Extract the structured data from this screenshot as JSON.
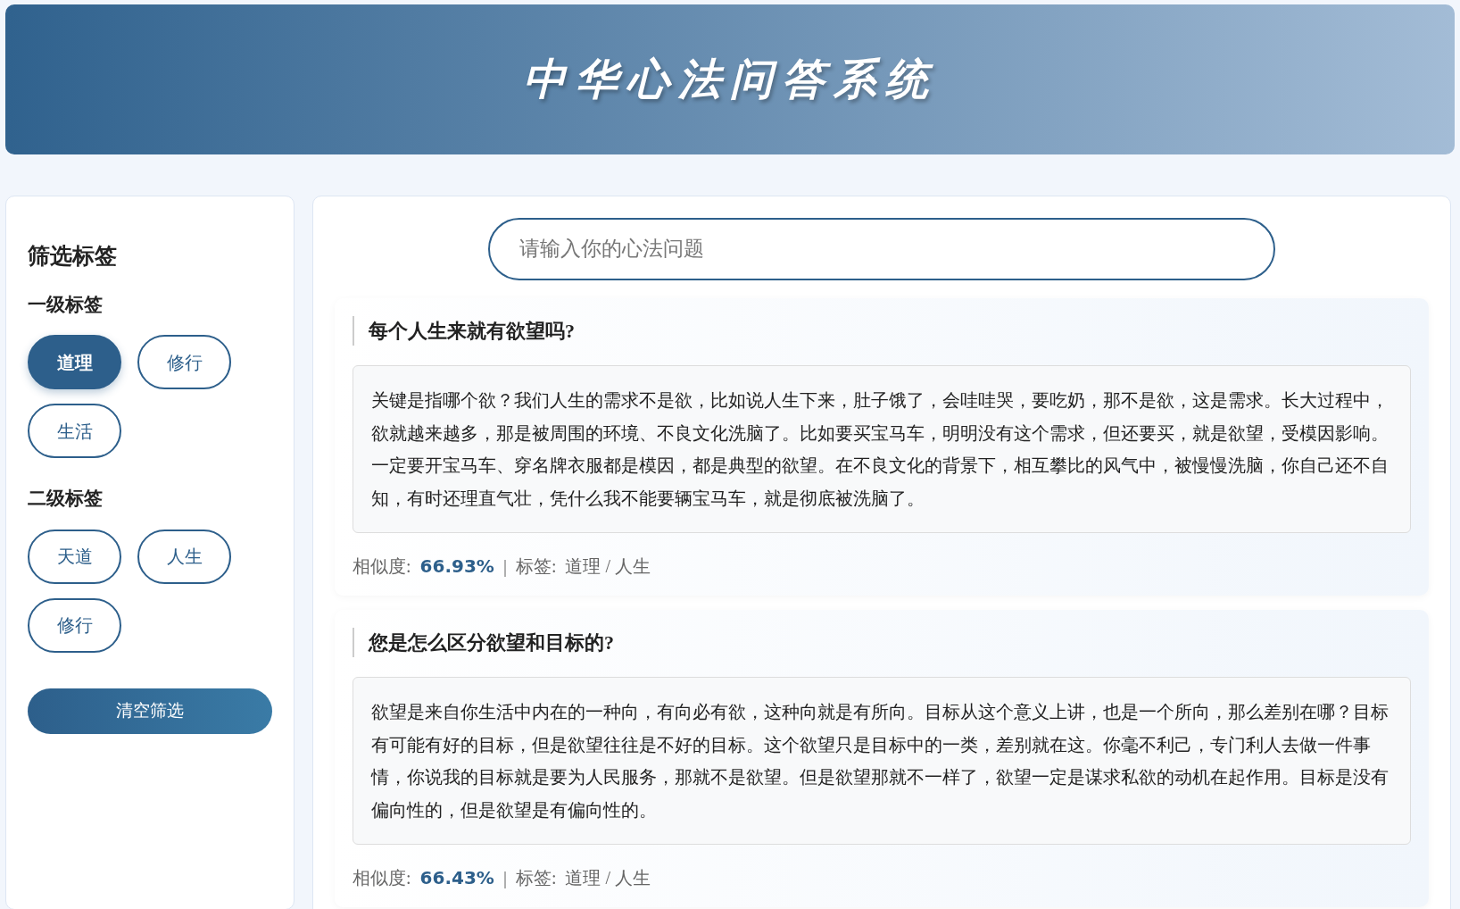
{
  "header": {
    "title": "中华心法问答系统"
  },
  "sidebar": {
    "title": "筛选标签",
    "groups": [
      {
        "title": "一级标签",
        "tags": [
          {
            "label": "道理",
            "selected": true
          },
          {
            "label": "修行",
            "selected": false
          },
          {
            "label": "生活",
            "selected": false
          }
        ]
      },
      {
        "title": "二级标签",
        "tags": [
          {
            "label": "天道",
            "selected": false
          },
          {
            "label": "人生",
            "selected": false
          },
          {
            "label": "修行",
            "selected": false
          }
        ]
      }
    ],
    "clear_button": "清空筛选"
  },
  "search": {
    "placeholder": "请输入你的心法问题"
  },
  "results": [
    {
      "question": "每个人生来就有欲望吗?",
      "answer": "关键是指哪个欲？我们人生的需求不是欲，比如说人生下来，肚子饿了，会哇哇哭，要吃奶，那不是欲，这是需求。长大过程中，欲就越来越多，那是被周围的环境、不良文化洗脑了。比如要买宝马车，明明没有这个需求，但还要买，就是欲望，受模因影响。一定要开宝马车、穿名牌衣服都是模因，都是典型的欲望。在不良文化的背景下，相互攀比的风气中，被慢慢洗脑，你自己还不自知，有时还理直气壮，凭什么我不能要辆宝马车，就是彻底被洗脑了。",
      "similarity_label": "相似度:",
      "similarity": "66.93%",
      "divider": "|",
      "tags_label": "标签:",
      "tags": "道理 / 人生"
    },
    {
      "question": "您是怎么区分欲望和目标的?",
      "answer": "欲望是来自你生活中内在的一种向，有向必有欲，这种向就是有所向。目标从这个意义上讲，也是一个所向，那么差别在哪？目标有可能有好的目标，但是欲望往往是不好的目标。这个欲望只是目标中的一类，差别就在这。你毫不利己，专门利人去做一件事情，你说我的目标就是要为人民服务，那就不是欲望。但是欲望那就不一样了，欲望一定是谋求私欲的动机在起作用。目标是没有偏向性的，但是欲望是有偏向性的。",
      "similarity_label": "相似度:",
      "similarity": "66.43%",
      "divider": "|",
      "tags_label": "标签:",
      "tags": "道理 / 人生"
    }
  ]
}
